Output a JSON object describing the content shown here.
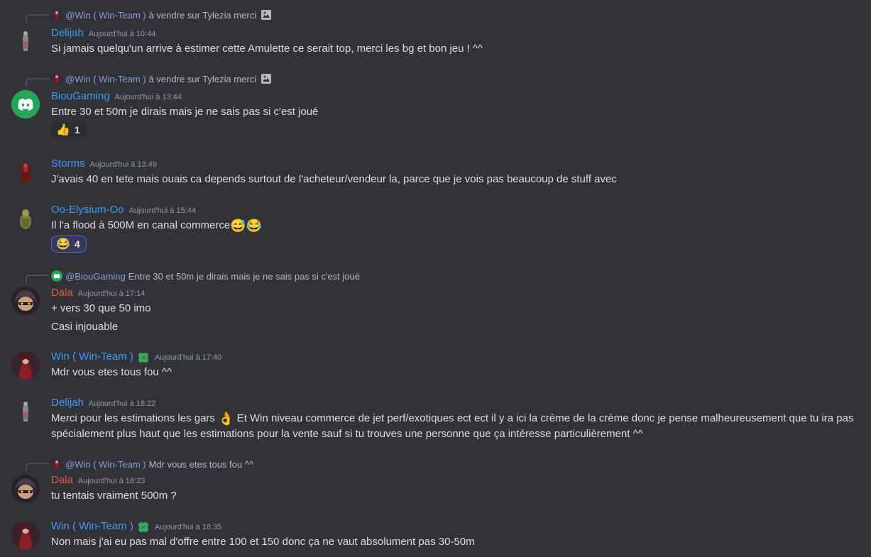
{
  "colors": {
    "background": "#313338",
    "blue_user": "#3f9bf5",
    "red_user": "#e05a4a",
    "mention": "#8b9bd4"
  },
  "messages": [
    {
      "reply": {
        "mention": "@Win ( Win-Team )",
        "text": "à vendre sur Tylezia merci",
        "icon": "image-icon"
      },
      "username": "Delijah",
      "timestamp": "Aujourd'hui à 10:44",
      "lines": [
        "Si jamais quelqu'un arrive à estimer cette Amulette ce serait top, merci les bg et bon jeu ! ^^"
      ]
    },
    {
      "reply": {
        "mention": "@Win ( Win-Team )",
        "text": "à vendre sur Tylezia merci",
        "icon": "image-icon"
      },
      "username": "BiouGaming",
      "timestamp": "Aujourd'hui à 13:44",
      "lines": [
        "Entre 30 et 50m je dirais mais je ne sais pas si c'est joué"
      ],
      "reaction": {
        "emoji": "👍",
        "count": "1"
      }
    },
    {
      "username": "Storms",
      "timestamp": "Aujourd'hui à 13:49",
      "lines": [
        "J'avais 40 en tete mais ouais ca depends surtout de l'acheteur/vendeur la, parce que je vois pas beaucoup de stuff avec"
      ]
    },
    {
      "username": "Oo-Elysium-Oo",
      "timestamp": "Aujourd'hui à 15:44",
      "lines": [
        "Il l'a flood à 500M en canal commerce"
      ],
      "inline_emojis": "😅😂",
      "reaction": {
        "emoji": "😂",
        "count": "4"
      }
    },
    {
      "reply": {
        "mention": "@BiouGaming",
        "text": "Entre 30 et 50m je dirais mais je ne sais pas si c'est joué"
      },
      "username": "Dala",
      "timestamp": "Aujourd'hui à 17:14",
      "lines": [
        "+ vers 30 que 50 imo",
        "Casi injouable"
      ]
    },
    {
      "username": "Win ( Win-Team )",
      "timestamp": "Aujourd'hui à 17:40",
      "badge": "clover-badge-icon",
      "lines": [
        "Mdr vous etes tous fou ^^"
      ]
    },
    {
      "username": "Delijah",
      "timestamp": "Aujourd'hui à 18:22",
      "line_before_emoji": "Merci pour les estimations les gars",
      "inline_emoji": "👌",
      "line_after_emoji": " Et Win niveau commerce de jet perf/exotiques ect ect il y a ici la crème de la crème donc je pense malheureusement que tu ira pas spécialement plus haut que les estimations pour la vente sauf si tu trouves une personne que ça intéresse particulièrement ^^"
    },
    {
      "reply": {
        "mention": "@Win ( Win-Team )",
        "text": "Mdr vous etes tous fou ^^"
      },
      "username": "Dala",
      "timestamp": "Aujourd'hui à 18:23",
      "lines": [
        "tu tentais vraiment 500m ?"
      ]
    },
    {
      "username": "Win ( Win-Team )",
      "timestamp": "Aujourd'hui à 18:35",
      "badge": "clover-badge-icon",
      "lines": [
        "Non mais j'ai eu pas mal d'offre entre 100 et 150 donc ça ne vaut absolument pas 30-50m"
      ]
    }
  ]
}
